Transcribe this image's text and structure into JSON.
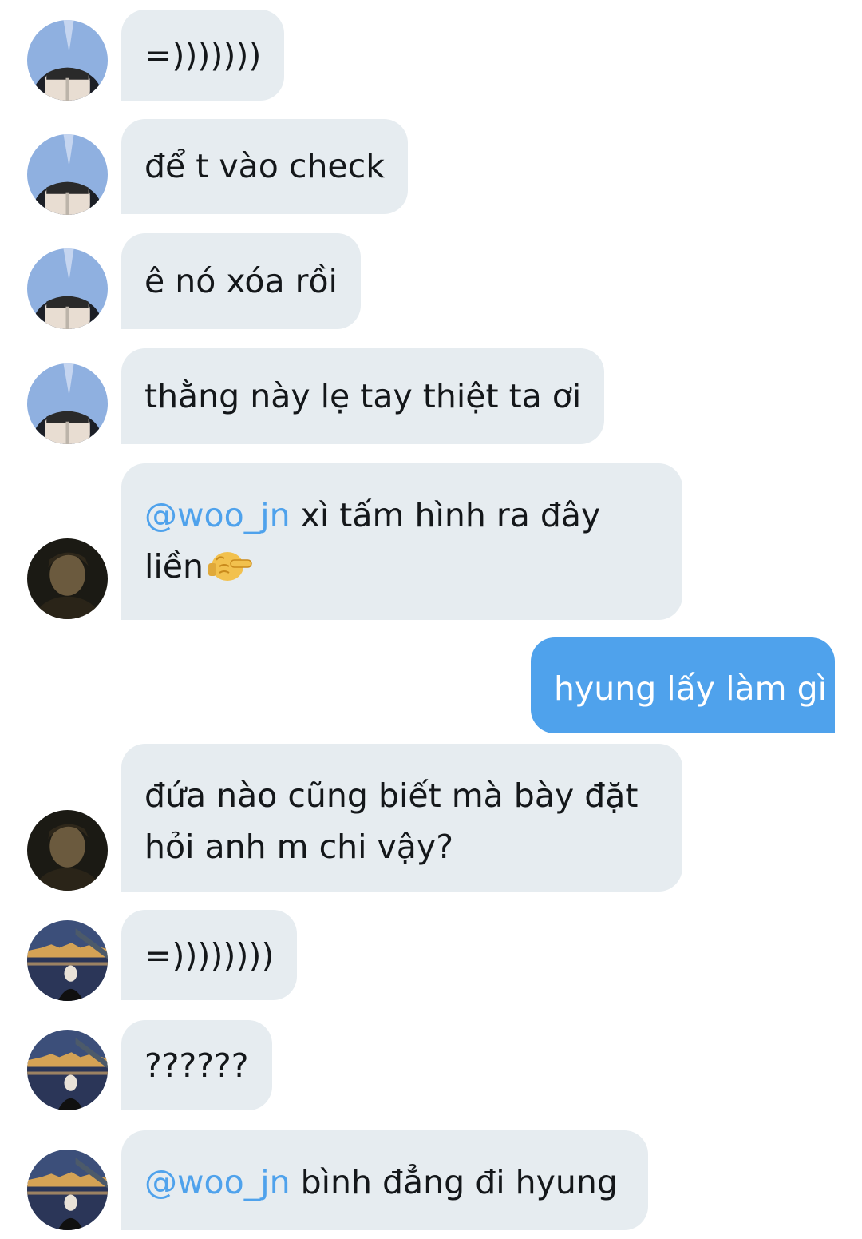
{
  "messages": [
    {
      "id": "m1",
      "direction": "incoming",
      "sender_avatar": "avatar-sky-selfie",
      "text": "=)))))))"
    },
    {
      "id": "m2",
      "direction": "incoming",
      "sender_avatar": "avatar-sky-selfie",
      "text": "để t vào check"
    },
    {
      "id": "m3",
      "direction": "incoming",
      "sender_avatar": "avatar-sky-selfie",
      "text": "ê nó xóa rồi"
    },
    {
      "id": "m4",
      "direction": "incoming",
      "sender_avatar": "avatar-sky-selfie",
      "text": "thằng này lẹ tay thiệt ta ơi"
    },
    {
      "id": "m5",
      "direction": "incoming",
      "sender_avatar": "avatar-dark-portrait",
      "mention": "@woo_jn",
      "line1": " xì tấm hình ra đây",
      "line2": "liền",
      "emoji": "pointing-fist-icon"
    },
    {
      "id": "m6",
      "direction": "outgoing",
      "text": "hyung lấy làm gì"
    },
    {
      "id": "m7",
      "direction": "incoming",
      "sender_avatar": "avatar-dark-portrait",
      "line1": "đứa nào cũng biết mà bày đặt",
      "line2": "hỏi anh m chi vậy?"
    },
    {
      "id": "m8",
      "direction": "incoming",
      "sender_avatar": "avatar-river-night",
      "text": "=))))))))"
    },
    {
      "id": "m9",
      "direction": "incoming",
      "sender_avatar": "avatar-river-night",
      "text": "??????"
    },
    {
      "id": "m10",
      "direction": "incoming",
      "sender_avatar": "avatar-river-night",
      "mention": "@woo_jn",
      "text": " bình đẳng đi hyung"
    }
  ],
  "colors": {
    "incoming_bubble": "#e6ecf0",
    "outgoing_bubble": "#4fa2ec",
    "mention": "#4fa2ec",
    "text": "#14171a"
  }
}
